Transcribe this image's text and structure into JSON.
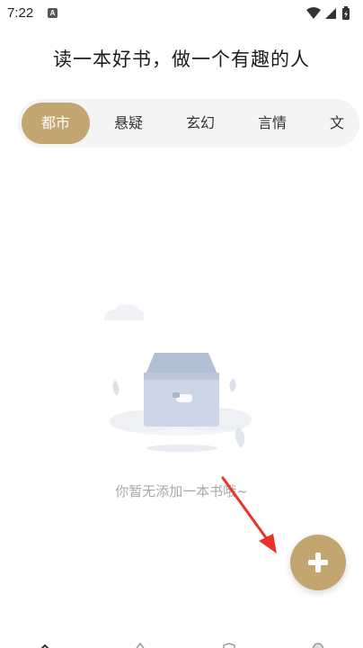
{
  "status_bar": {
    "time": "7:22",
    "notification_icon_letter": "A",
    "icons": [
      "wifi-icon",
      "signal-icon",
      "battery-icon"
    ]
  },
  "header": {
    "title": "读一本好书，做一个有趣的人"
  },
  "tabs": [
    {
      "label": "都市",
      "active": true
    },
    {
      "label": "悬疑",
      "active": false
    },
    {
      "label": "玄幻",
      "active": false
    },
    {
      "label": "言情",
      "active": false
    },
    {
      "label": "文",
      "active": false
    }
  ],
  "empty_state": {
    "message": "你暂无添加一本书哦~",
    "illustration": "empty-box-icon"
  },
  "fab": {
    "icon": "plus-icon"
  },
  "annotation": {
    "type": "red-arrow",
    "color": "#e5352b"
  },
  "bottom_nav": {
    "icons": [
      "home-icon",
      "bookshelf-icon",
      "map-icon",
      "profile-icon"
    ]
  },
  "colors": {
    "accent": "#c3a56f",
    "tab_bar_bg": "#f4f4f4",
    "empty_text": "#a8a8a8"
  }
}
